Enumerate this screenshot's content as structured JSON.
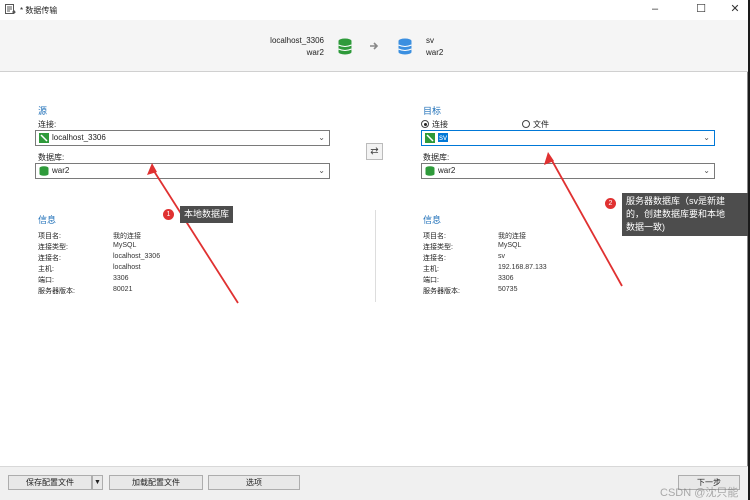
{
  "window": {
    "title": "* 数据传输",
    "min": "–",
    "max": "☐",
    "close": "✕"
  },
  "header": {
    "source_conn": "localhost_3306",
    "source_db": "war2",
    "target_conn": "sv",
    "target_db": "war2"
  },
  "source": {
    "title": "源",
    "conn_label": "连接:",
    "conn_value": "localhost_3306",
    "db_label": "数据库:",
    "db_value": "war2"
  },
  "target": {
    "title": "目标",
    "radio_conn": "连接",
    "radio_file": "文件",
    "conn_value": "sv",
    "db_label": "数据库:",
    "db_value": "war2"
  },
  "source_info": {
    "title": "信息",
    "rows": [
      {
        "k": "项目名:",
        "v": "我的连接"
      },
      {
        "k": "连接类型:",
        "v": "MySQL"
      },
      {
        "k": "连接名:",
        "v": "localhost_3306"
      },
      {
        "k": "主机:",
        "v": "localhost"
      },
      {
        "k": "端口:",
        "v": "3306"
      },
      {
        "k": "服务器版本:",
        "v": "80021"
      }
    ]
  },
  "target_info": {
    "title": "信息",
    "rows": [
      {
        "k": "项目名:",
        "v": "我的连接"
      },
      {
        "k": "连接类型:",
        "v": "MySQL"
      },
      {
        "k": "连接名:",
        "v": "sv"
      },
      {
        "k": "主机:",
        "v": "192.168.87.133"
      },
      {
        "k": "端口:",
        "v": "3306"
      },
      {
        "k": "服务器版本:",
        "v": "50735"
      }
    ]
  },
  "footer": {
    "save_profile": "保存配置文件",
    "load_profile": "加载配置文件",
    "options": "选项",
    "next": "下一步"
  },
  "annotations": {
    "badge1": "1",
    "callout1": "本地数据库",
    "badge2": "2",
    "callout2_l1": "服务器数据库（sv是新建",
    "callout2_l2": "的，创建数据库要和本地",
    "callout2_l3": "数据一致)"
  },
  "watermark": "CSDN @沈只能",
  "colors": {
    "accent": "#1e6fb8",
    "annotation_red": "#e03131",
    "callout_bg": "#4d4d4d",
    "db_green": "#2e9a3a",
    "db_blue": "#3b8fe0"
  }
}
